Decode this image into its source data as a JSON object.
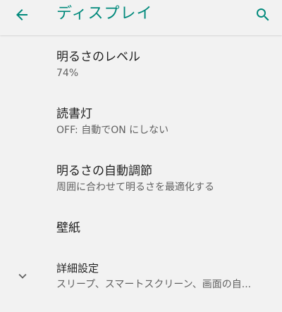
{
  "appbar": {
    "title": "ディスプレイ",
    "back_icon": "arrow-back-icon",
    "search_icon": "search-icon",
    "accent_color": "#00897b"
  },
  "settings": {
    "brightness_level": {
      "title": "明るさのレベル",
      "summary": "74%"
    },
    "night_light": {
      "title": "読書灯",
      "summary": "OFF: 自動でON にしない"
    },
    "adaptive_brightness": {
      "title": "明るさの自動調節",
      "summary": "周囲に合わせて明るさを最適化する"
    },
    "wallpaper": {
      "title": "壁紙"
    },
    "advanced": {
      "title": "詳細設定",
      "summary": "スリープ、スマートスクリーン、画面の自...",
      "expand_icon": "chevron-down-icon"
    }
  }
}
